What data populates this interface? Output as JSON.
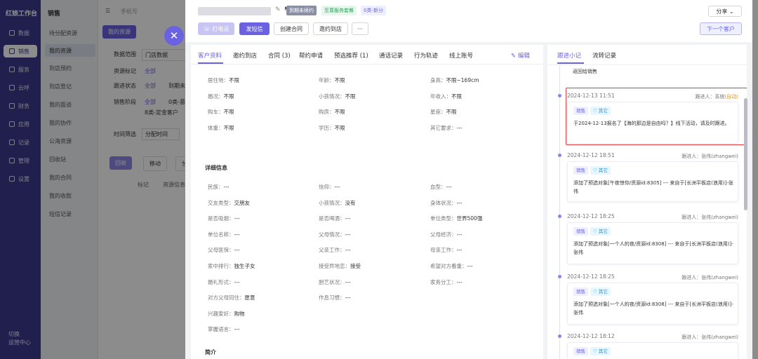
{
  "nav": {
    "brand": "红娘工作台",
    "items": [
      "数据",
      "销售",
      "服务",
      "云呼",
      "财务",
      "应用",
      "记录",
      "管理",
      "设置"
    ],
    "footer": [
      "切换",
      "运营中心"
    ]
  },
  "sub": {
    "title": "销售",
    "items": [
      "待分配资源",
      "我的资源",
      "到店预约",
      "到店登记",
      "我的面谈",
      "我的协作",
      "公海资源",
      "回收站",
      "我的合同",
      "我的收款",
      "短信记录"
    ]
  },
  "main": {
    "search_placeholder": "手机号",
    "tab": "我的资源",
    "filters": [
      "数据范围",
      "门店数据",
      "资源标记",
      "全部",
      "跟进状态",
      "全部",
      "到期未",
      "销售阶段",
      "全部",
      "0类-意",
      "8类-定金客户",
      "时间筛选",
      "分配时间"
    ],
    "buttons": [
      "回收",
      "移动",
      "分"
    ],
    "columns": [
      "标记",
      "资源信息"
    ]
  },
  "drawer": {
    "header": {
      "tags": [
        "到期未续约",
        "至尊服务套餐",
        "0类-新分"
      ],
      "share": "分享",
      "buttons": [
        "打电话",
        "发短信",
        "创建合同",
        "邀约到店",
        "···"
      ],
      "next": "下一个客户"
    },
    "tabs": [
      "客户资料",
      "邀约到店",
      "合同 (3)",
      "帮约申请",
      "预选推荐 (1)",
      "通话记录",
      "行为轨迹",
      "线上账号"
    ],
    "edit": "编辑",
    "fields_top": [
      [
        "居住地",
        "不限"
      ],
      [
        "年龄",
        "不限"
      ],
      [
        "身高",
        "不限~169cm"
      ],
      [
        "婚况",
        "不限"
      ],
      [
        "小孩情况",
        "不限"
      ],
      [
        "年收入",
        "不限"
      ],
      [
        "购车",
        "不限"
      ],
      [
        "购房",
        "不限"
      ],
      [
        "星座",
        "不限"
      ],
      [
        "体重",
        "不限"
      ],
      [
        "学历",
        "不限"
      ],
      [
        "其它要求",
        "---"
      ]
    ],
    "section_detail": "详细信息",
    "fields_detail": [
      [
        "民族",
        "---"
      ],
      [
        "信仰",
        "---"
      ],
      [
        "血型",
        "---"
      ],
      [
        "交友类型",
        "交朋友"
      ],
      [
        "小孩情况",
        "没有"
      ],
      [
        "身体状况",
        "---"
      ],
      [
        "是否吸烟",
        "---"
      ],
      [
        "是否喝酒",
        "---"
      ],
      [
        "单位类型",
        "世界500强"
      ],
      [
        "单位名称",
        "---"
      ],
      [
        "父母情况",
        "---"
      ],
      [
        "父母经济",
        "---"
      ],
      [
        "父母医保",
        "---"
      ],
      [
        "父亲工作",
        "---"
      ],
      [
        "母亲工作",
        "---"
      ],
      [
        "家中排行",
        "独生子女"
      ],
      [
        "接受异地恋",
        "接受"
      ],
      [
        "希望对方看重",
        "---"
      ],
      [
        "婚礼形式",
        "---"
      ],
      [
        "厨艺状况",
        "---"
      ],
      [
        "家务分工",
        "---"
      ],
      [
        "对方父母同住",
        "愿意"
      ],
      [
        "作息习惯",
        "---"
      ],
      [
        "",
        ""
      ],
      [
        "兴趣爱好",
        "购物"
      ],
      [
        "",
        ""
      ],
      [
        "",
        ""
      ],
      [
        "掌握语言",
        "---"
      ]
    ],
    "section_intro": "简介",
    "follow": {
      "tabs": [
        "跟进小记",
        "流转记录"
      ],
      "top_text": "返回给销售",
      "entries": [
        {
          "time": "2024-12-13 11:51",
          "who": "跟进人：系统",
          "who2": "(自动)",
          "chips": [
            "销售",
            "其它"
          ],
          "text": "于2024-12-13报名了【海的那边是自由吗？】线下活动，请及时跟进。"
        },
        {
          "time": "2024-12-12 18:51",
          "who": "跟进人：张伟(zhangwei)",
          "chips": [
            "销售",
            "其它"
          ],
          "text": "添加了预选对象[午夜惊你/资源id:8305] --- 来自于[长洲平板店(浪用)]-张伟"
        },
        {
          "time": "2024-12-12 18:25",
          "who": "跟进人：张伟(zhangwei)",
          "chips": [
            "销售",
            "其它"
          ],
          "text": "添加了预选对象[一个人的夜/资源id:8308] --- 来自于[长洲平板店(浪用)]-张伟"
        },
        {
          "time": "2024-12-12 18:25",
          "who": "跟进人：张伟(zhangwei)",
          "chips": [
            "销售",
            "其它"
          ],
          "text": "添加了预选对象[一个人的夜/资源id:8308] --- 来自于[长洲平板店(浪用)]-张伟"
        },
        {
          "time": "2024-12-12 18:12",
          "who": "跟进人：张伟(zhangwei)",
          "chips": [
            "销售",
            "其它"
          ],
          "text": ""
        }
      ]
    }
  },
  "colors": {
    "accent": "#6a62e0",
    "nav": "#3d3a8c",
    "highlight": "#e23b3b"
  }
}
